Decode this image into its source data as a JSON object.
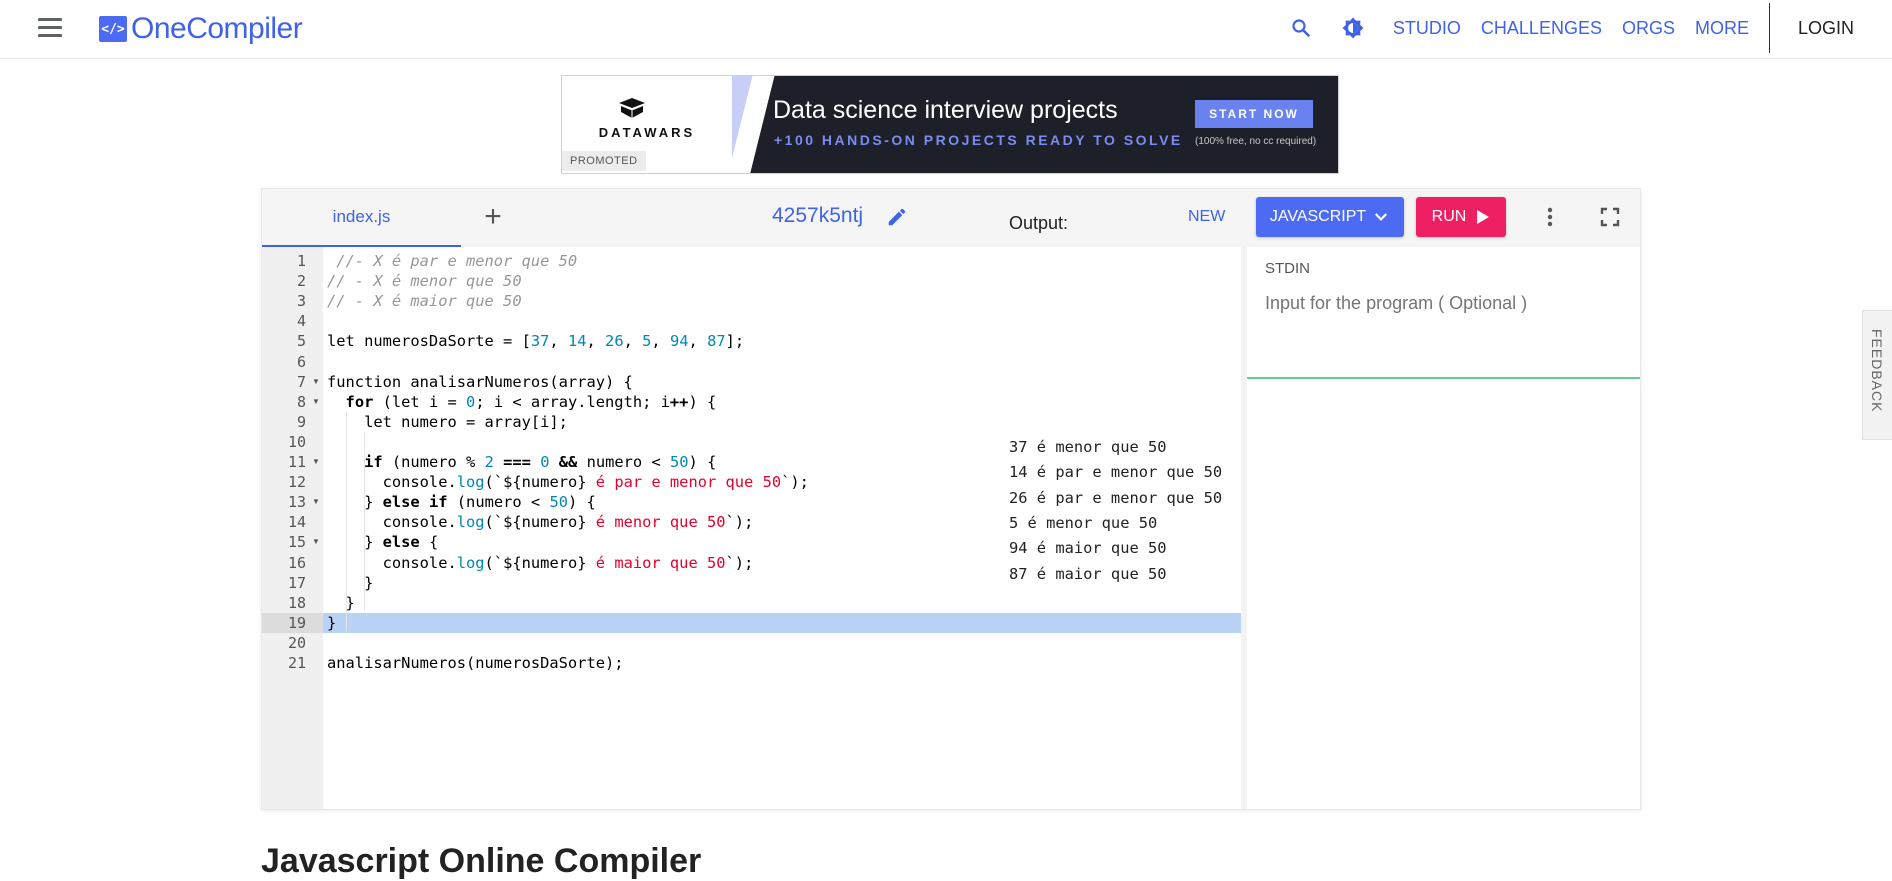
{
  "nav": {
    "logo_mark": "</>",
    "logo_text": "OneCompiler",
    "links": [
      "STUDIO",
      "CHALLENGES",
      "ORGS",
      "MORE"
    ],
    "login": "LOGIN"
  },
  "ad": {
    "brand": "DATAWARS",
    "promoted": "PROMOTED",
    "title": "Data science interview projects",
    "subtitle": "+100 HANDS-ON PROJECTS READY TO SOLVE",
    "button": "START NOW",
    "note": "(100% free, no cc required)"
  },
  "editor": {
    "file_tab": "index.js",
    "add_tab": "+",
    "code_name": "4257k5ntj",
    "new_label": "NEW",
    "language": "JAVASCRIPT",
    "run_label": "RUN",
    "highlighted_line": 19,
    "lines": [
      " //- X é par e menor que 50",
      "// - X é menor que 50",
      "// - X é maior que 50",
      "",
      "let numerosDaSorte = [37, 14, 26, 5, 94, 87];",
      "",
      "function analisarNumeros(array) {",
      "  for (let i = 0; i < array.length; i++) {",
      "    let numero = array[i];",
      "",
      "    if (numero % 2 === 0 && numero < 50) {",
      "      console.log(`${numero} é par e menor que 50`);",
      "    } else if (numero < 50) {",
      "      console.log(`${numero} é menor que 50`);",
      "    } else {",
      "      console.log(`${numero} é maior que 50`);",
      "    }",
      "  }",
      "}",
      "",
      "analisarNumeros(numerosDaSorte);"
    ],
    "fold_lines": [
      7,
      8,
      11,
      13,
      15
    ]
  },
  "io": {
    "stdin_label": "STDIN",
    "stdin_placeholder": "Input for the program ( Optional )",
    "output_label": "Output:",
    "output_lines": [
      "37 é menor que 50",
      "14 é par e menor que 50",
      "26 é par e menor que 50",
      "5 é menor que 50",
      "94 é maior que 50",
      "87 é maior que 50"
    ]
  },
  "feedback": "FEEDBACK",
  "page_heading": "Javascript Online Compiler",
  "colors": {
    "accent": "#3f62e8",
    "run": "#ef1f63",
    "stdin_border": "#5ed191",
    "highlight": "#b9d3f7"
  }
}
